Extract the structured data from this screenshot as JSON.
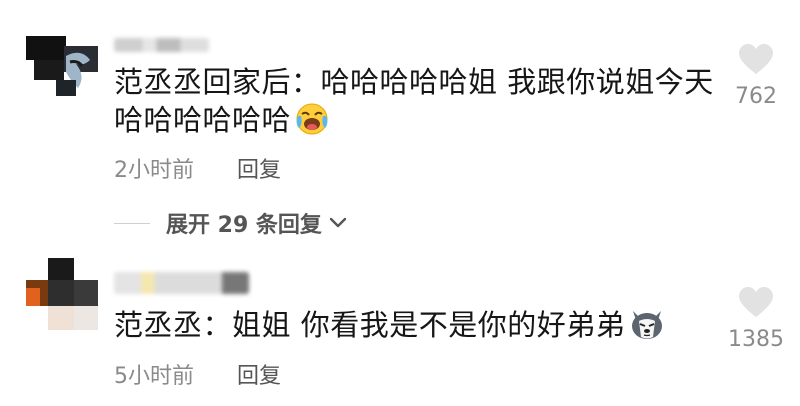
{
  "comments": [
    {
      "text_line1": "范丞丞回家后：哈哈哈哈哈姐 我跟你说姐今天",
      "text_line2": "哈哈哈哈哈哈",
      "emoji": "laughing-crying-emoji",
      "time": "2小时前",
      "reply_label": "回复",
      "likes": "762",
      "expand_label": "展开 29 条回复"
    },
    {
      "text_line1": "范丞丞：姐姐 你看我是不是你的好弟弟",
      "emoji": "husky-dog-emoji",
      "time": "5小时前",
      "reply_label": "回复",
      "likes": "1385"
    }
  ],
  "icons": {
    "like": "heart-icon",
    "expand": "chevron-down-icon"
  },
  "colors": {
    "text": "#161616",
    "meta": "#8a8a8a",
    "heart": "#e2e2e2"
  }
}
